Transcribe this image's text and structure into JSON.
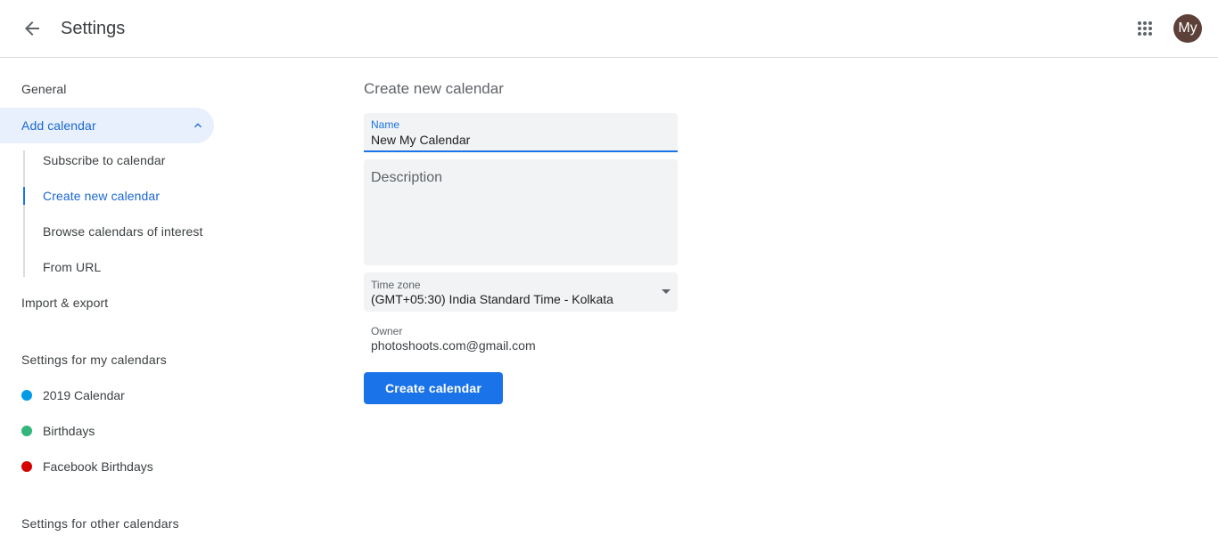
{
  "header": {
    "title": "Settings",
    "back_icon": "arrow-left-icon",
    "apps_icon": "grid-apps-icon",
    "avatar_initials": "My",
    "avatar_color": "#5d4037"
  },
  "sidebar": {
    "general": "General",
    "add_calendar": "Add calendar",
    "add_calendar_sub": [
      {
        "label": "Subscribe to calendar"
      },
      {
        "label": "Create new calendar"
      },
      {
        "label": "Browse calendars of interest"
      },
      {
        "label": "From URL"
      }
    ],
    "import_export": "Import & export",
    "my_calendars_heading": "Settings for my calendars",
    "my_calendars": [
      {
        "label": "2019 Calendar",
        "color": "#039be5"
      },
      {
        "label": "Birthdays",
        "color": "#33b679"
      },
      {
        "label": "Facebook Birthdays",
        "color": "#d50000"
      }
    ],
    "other_calendars_heading": "Settings for other calendars"
  },
  "form": {
    "title": "Create new calendar",
    "name_label": "Name",
    "name_value": "New My Calendar",
    "description_placeholder": "Description",
    "timezone_label": "Time zone",
    "timezone_value": "(GMT+05:30) India Standard Time - Kolkata",
    "owner_label": "Owner",
    "owner_value": "photoshoots.com@gmail.com",
    "create_button": "Create calendar",
    "accent_color": "#1a73e8"
  }
}
